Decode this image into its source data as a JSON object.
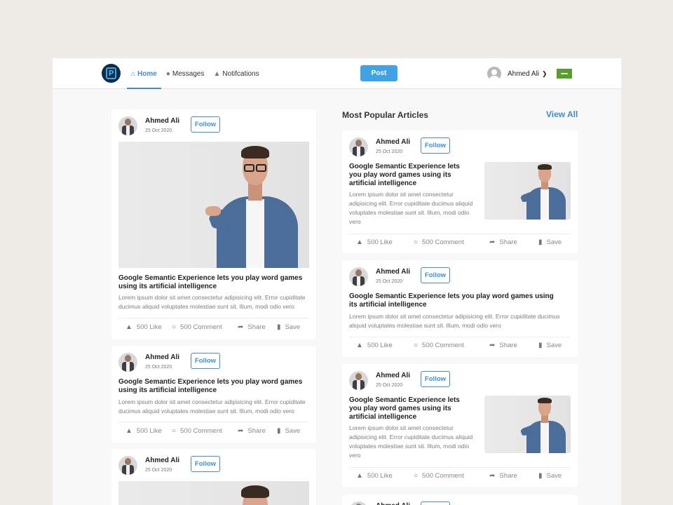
{
  "nav": {
    "home": "Home",
    "messages": "Messages",
    "notifications": "Notifcations",
    "post_button": "Post",
    "user_name": "Ahmed Ali"
  },
  "section": {
    "title": "Most Popular Articles",
    "view_all": "View All"
  },
  "common": {
    "author": "Ahmed Ali",
    "date": "25 Oct 2020",
    "follow": "Follow",
    "title": "Google Semantic Experience lets you play word games using its artificial intelligence",
    "excerpt": "Lorem ipsum dolor sit amet consectetur adipisicing elit. Error cupiditate ducimus aliquid voluptates molestiae sunt sit. Illum, modi odio vero",
    "like": "500 Like",
    "comment": "500 Comment",
    "share": "Share",
    "save": "Save"
  },
  "colors": {
    "accent": "#3e8ccf",
    "post_button": "#3fa3e6",
    "background": "#efebe7"
  }
}
